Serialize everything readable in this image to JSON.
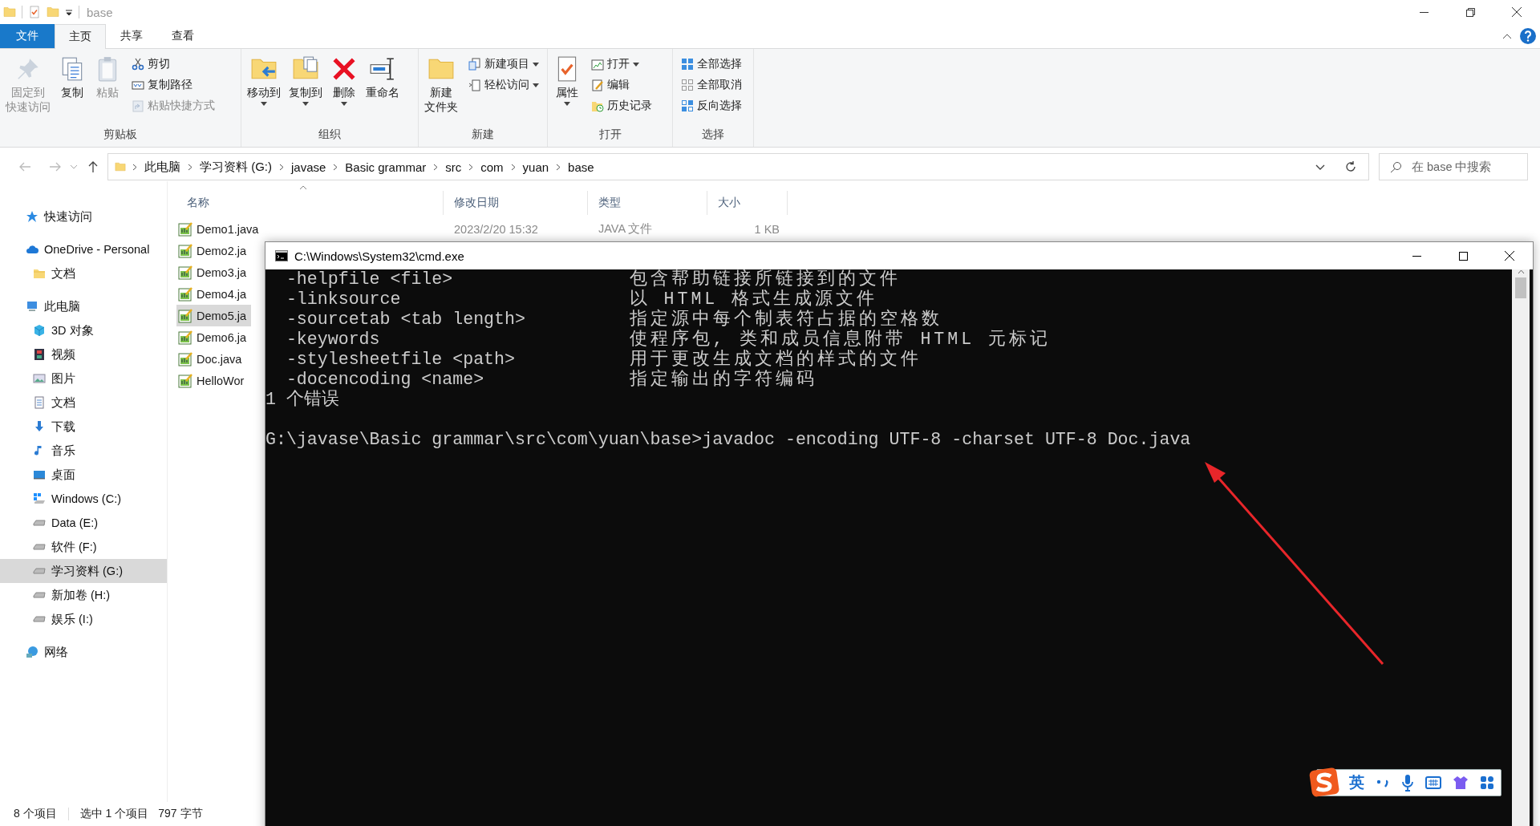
{
  "explorer": {
    "title": "base",
    "ribbon_tabs": [
      {
        "label": "文件",
        "kind": "menu",
        "selected": false
      },
      {
        "label": "主页",
        "kind": "tab",
        "selected": true
      },
      {
        "label": "共享",
        "kind": "tab",
        "selected": false
      },
      {
        "label": "查看",
        "kind": "tab",
        "selected": false
      }
    ],
    "ribbon_groups": [
      {
        "label": "剪贴板",
        "items": [
          {
            "label_lines": [
              "固定到",
              "快速访问"
            ],
            "kind": "large",
            "disabled": true,
            "dropdown": false
          },
          {
            "label": "复制",
            "kind": "large",
            "disabled": false,
            "dropdown": false
          },
          {
            "label": "粘贴",
            "kind": "large",
            "disabled": true,
            "dropdown": false
          },
          {
            "label": "剪切",
            "kind": "small",
            "disabled": false,
            "dropdown": false
          },
          {
            "label": "复制路径",
            "kind": "small",
            "disabled": false,
            "dropdown": false
          },
          {
            "label": "粘贴快捷方式",
            "kind": "small",
            "disabled": true,
            "dropdown": false
          }
        ]
      },
      {
        "label": "组织",
        "items": [
          {
            "label": "移动到",
            "kind": "large",
            "disabled": false,
            "dropdown": true
          },
          {
            "label": "复制到",
            "kind": "large",
            "disabled": false,
            "dropdown": true
          },
          {
            "label": "删除",
            "kind": "large",
            "disabled": false,
            "dropdown": true
          },
          {
            "label": "重命名",
            "kind": "large",
            "disabled": false,
            "dropdown": false
          }
        ]
      },
      {
        "label": "新建",
        "items": [
          {
            "label_lines": [
              "新建",
              "文件夹"
            ],
            "kind": "large",
            "disabled": false,
            "dropdown": false
          },
          {
            "label": "新建项目",
            "kind": "small",
            "disabled": false,
            "dropdown": true
          },
          {
            "label": "轻松访问",
            "kind": "small",
            "disabled": false,
            "dropdown": true
          }
        ]
      },
      {
        "label": "打开",
        "items": [
          {
            "label": "属性",
            "kind": "large",
            "disabled": false,
            "dropdown": true
          },
          {
            "label": "打开",
            "kind": "small",
            "disabled": false,
            "dropdown": true
          },
          {
            "label": "编辑",
            "kind": "small",
            "disabled": false,
            "dropdown": false
          },
          {
            "label": "历史记录",
            "kind": "small",
            "disabled": false,
            "dropdown": false
          }
        ]
      },
      {
        "label": "选择",
        "items": [
          {
            "label": "全部选择",
            "kind": "small",
            "disabled": false,
            "dropdown": false
          },
          {
            "label": "全部取消",
            "kind": "small",
            "disabled": false,
            "dropdown": false
          },
          {
            "label": "反向选择",
            "kind": "small",
            "disabled": false,
            "dropdown": false
          }
        ]
      }
    ],
    "address": {
      "breadcrumbs": [
        "此电脑",
        "学习资料 (G:)",
        "javase",
        "Basic grammar",
        "src",
        "com",
        "yuan",
        "base"
      ]
    },
    "search": {
      "placeholder": "在 base 中搜索"
    },
    "nav": [
      {
        "label": "快速访问",
        "selected": false
      },
      {
        "label": "OneDrive - Personal",
        "selected": false,
        "children": [
          {
            "label": "文档",
            "selected": false
          }
        ]
      },
      {
        "label": "此电脑",
        "selected": false,
        "children": [
          {
            "label": "3D 对象",
            "selected": false
          },
          {
            "label": "视频",
            "selected": false
          },
          {
            "label": "图片",
            "selected": false
          },
          {
            "label": "文档",
            "selected": false
          },
          {
            "label": "下载",
            "selected": false
          },
          {
            "label": "音乐",
            "selected": false
          },
          {
            "label": "桌面",
            "selected": false
          },
          {
            "label": "Windows (C:)",
            "selected": false
          },
          {
            "label": "Data (E:)",
            "selected": false
          },
          {
            "label": "软件 (F:)",
            "selected": false
          },
          {
            "label": "学习资料 (G:)",
            "selected": true
          },
          {
            "label": "新加卷 (H:)",
            "selected": false
          },
          {
            "label": "娱乐 (I:)",
            "selected": false
          }
        ]
      },
      {
        "label": "网络",
        "selected": false
      }
    ],
    "columns": [
      "名称",
      "修改日期",
      "类型",
      "大小"
    ],
    "files": [
      {
        "name": "Demo1.java",
        "modified": "2023/2/20 15:32",
        "type": "JAVA 文件",
        "size": "1 KB",
        "selected": false
      },
      {
        "name": "Demo2.ja",
        "selected": false
      },
      {
        "name": "Demo3.ja",
        "selected": false
      },
      {
        "name": "Demo4.ja",
        "selected": false
      },
      {
        "name": "Demo5.ja",
        "selected": true
      },
      {
        "name": "Demo6.ja",
        "selected": false
      },
      {
        "name": "Doc.java",
        "selected": false
      },
      {
        "name": "HelloWor",
        "selected": false
      }
    ],
    "status_bar": [
      "8 个项目",
      "选中 1 个项目",
      "797 字节"
    ]
  },
  "cmd": {
    "title": "C:\\Windows\\System32\\cmd.exe",
    "lines": [
      {
        "kind": "option",
        "option": "-helpfile <file>",
        "description": "包含帮助链接所链接到的文件"
      },
      {
        "kind": "option",
        "option": "-linksource",
        "description": "以 HTML 格式生成源文件"
      },
      {
        "kind": "option",
        "option": "-sourcetab <tab length>",
        "description": "指定源中每个制表符占据的空格数"
      },
      {
        "kind": "option",
        "option": "-keywords",
        "description": "使程序包, 类和成员信息附带 HTML 元标记"
      },
      {
        "kind": "option",
        "option": "-stylesheetfile <path>",
        "description": "用于更改生成文档的样式的文件"
      },
      {
        "kind": "option",
        "option": "-docencoding <name>",
        "description": "指定输出的字符编码"
      },
      {
        "kind": "text",
        "text": "1 个错误"
      },
      {
        "kind": "prompt",
        "text": "G:\\javase\\Basic grammar\\src\\com\\yuan\\base>javadoc -encoding UTF-8 -charset UTF-8 Doc.java"
      }
    ]
  },
  "ime": {
    "mode": "英"
  }
}
